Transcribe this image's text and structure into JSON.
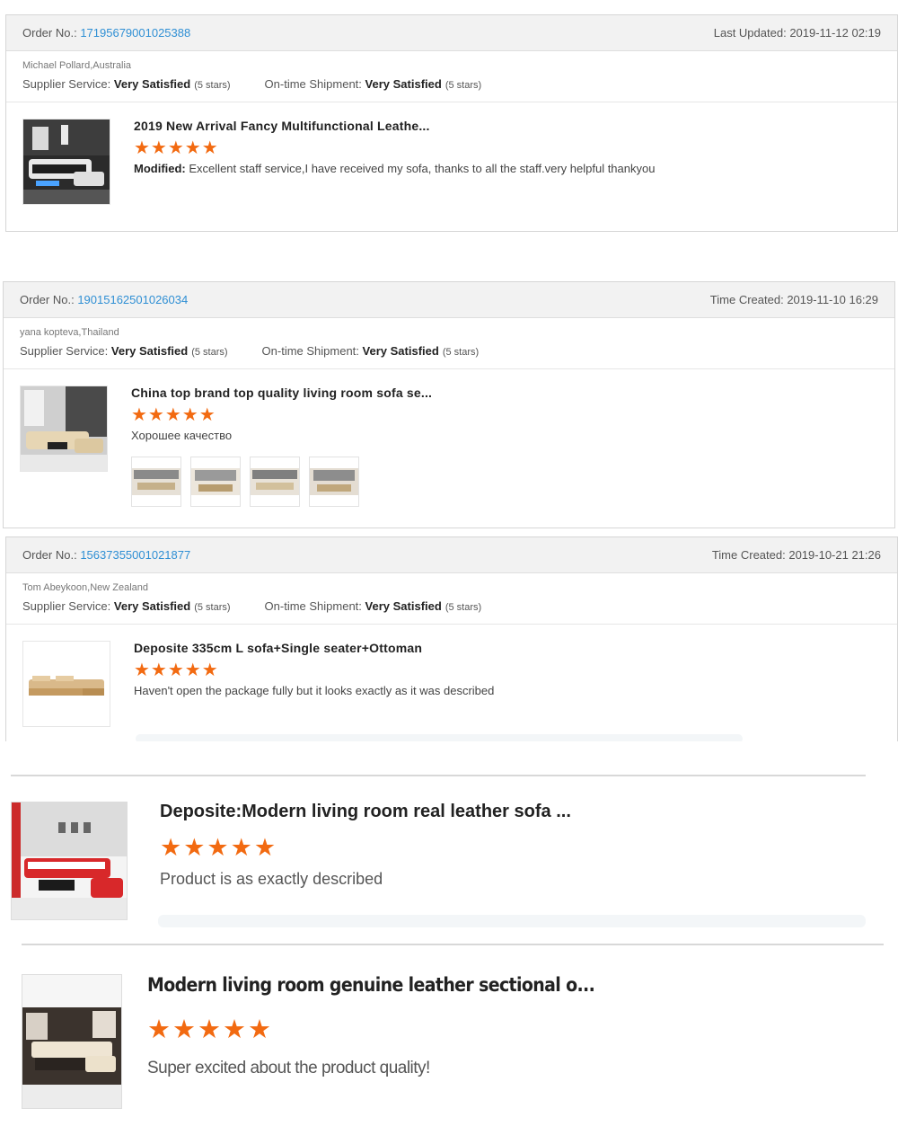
{
  "reviews": [
    {
      "order_label": "Order No.:",
      "order_no": "17195679001025388",
      "date_label": "Last Updated:",
      "date": "2019-11-12 02:19",
      "buyer": "Michael Pollard,Australia",
      "supplier_label": "Supplier Service:",
      "supplier_value": "Very Satisfied",
      "supplier_stars": "(5 stars)",
      "shipment_label": "On-time Shipment:",
      "shipment_value": "Very Satisfied",
      "shipment_stars": "(5 stars)",
      "product_title": "2019 New Arrival Fancy Multifunctional Leathe...",
      "stars": "★★★★★",
      "feedback_prefix": "Modified:",
      "feedback": "Excellent staff service,I have received my sofa, thanks to all the staff.very helpful thankyou"
    },
    {
      "order_label": "Order No.:",
      "order_no": "19015162501026034",
      "date_label": "Time Created:",
      "date": "2019-11-10 16:29",
      "buyer": "yana kopteva,Thailand",
      "supplier_label": "Supplier Service:",
      "supplier_value": "Very Satisfied",
      "supplier_stars": "(5 stars)",
      "shipment_label": "On-time Shipment:",
      "shipment_value": "Very Satisfied",
      "shipment_stars": "(5 stars)",
      "product_title": "China top brand top quality living room sofa se...",
      "stars": "★★★★★",
      "feedback": "Хорошее качество"
    },
    {
      "order_label": "Order No.:",
      "order_no": "15637355001021877",
      "date_label": "Time Created:",
      "date": "2019-10-21 21:26",
      "buyer": "Tom Abeykoon,New Zealand",
      "supplier_label": "Supplier Service:",
      "supplier_value": "Very Satisfied",
      "supplier_stars": "(5 stars)",
      "shipment_label": "On-time Shipment:",
      "shipment_value": "Very Satisfied",
      "shipment_stars": "(5 stars)",
      "product_title": "Deposite 335cm L sofa+Single seater+Ottoman",
      "stars": "★★★★★",
      "feedback": "Haven't open the package fully but it looks exactly as it was described"
    }
  ],
  "extra_items": [
    {
      "product_title": "Deposite:Modern living room real leather sofa ...",
      "stars": "★★★★★",
      "feedback": "Product is as exactly described"
    },
    {
      "product_title": "Modern living room genuine leather sectional o...",
      "stars": "★★★★★",
      "feedback": "Super excited about the product quality!"
    }
  ],
  "colors": {
    "link": "#2f8fd4",
    "star": "#f26a11",
    "header_bg": "#f2f2f2"
  }
}
